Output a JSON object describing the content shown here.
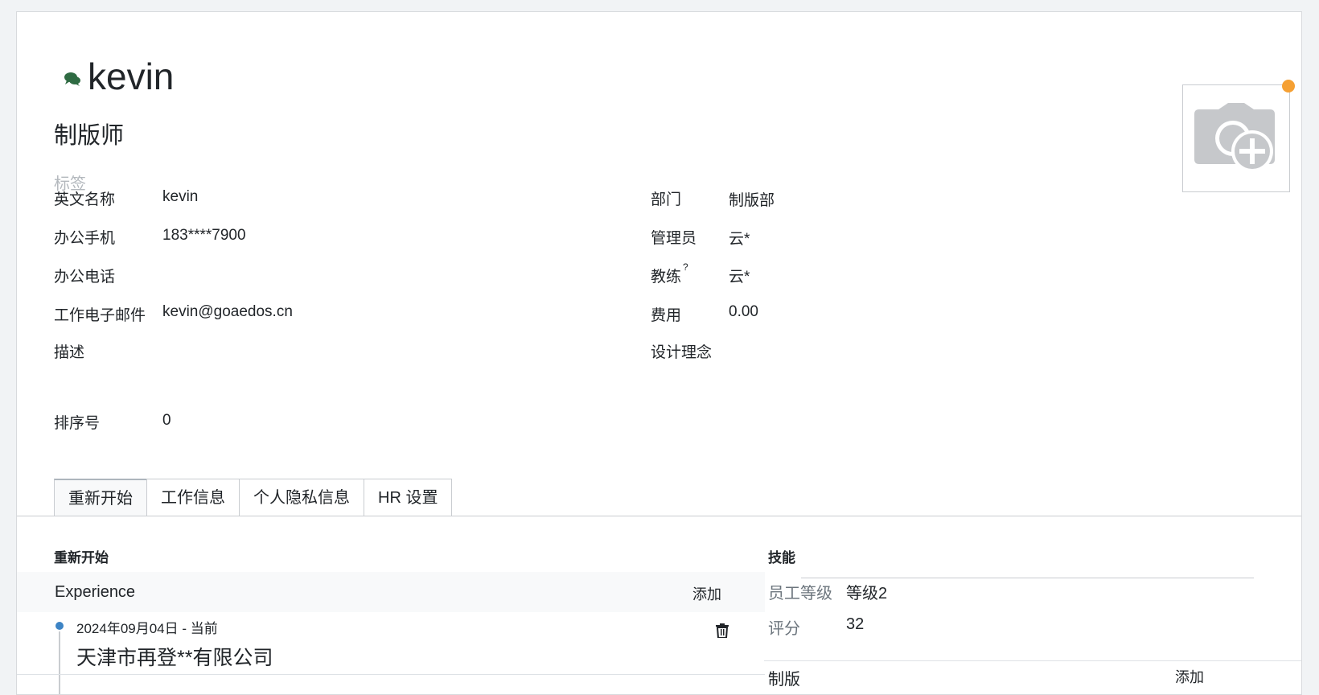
{
  "header": {
    "name": "kevin",
    "job_title": "制版师",
    "tags_placeholder": "标签"
  },
  "left_fields": [
    {
      "label": "英文名称",
      "value": "kevin"
    },
    {
      "label": "办公手机",
      "value": "183****7900"
    },
    {
      "label": "办公电话",
      "value": ""
    },
    {
      "label": "工作电子邮件",
      "value": "kevin@goaedos.cn"
    },
    {
      "label": "描述",
      "value": ""
    },
    {
      "label": "排序号",
      "value": "0"
    }
  ],
  "right_fields": [
    {
      "label": "部门",
      "value": "制版部"
    },
    {
      "label": "管理员",
      "value": "云*"
    },
    {
      "label": "教练",
      "value": "云*",
      "help": "?"
    },
    {
      "label": "费用",
      "value": "0.00"
    },
    {
      "label": "设计理念",
      "value": ""
    }
  ],
  "tabs": [
    "重新开始",
    "工作信息",
    "个人隐私信息",
    "HR 设置"
  ],
  "resume": {
    "section_title": "重新开始",
    "group_title": "Experience",
    "add_label": "添加",
    "entry": {
      "date": "2024年09月04日 - 当前",
      "company": "天津市再登**有限公司"
    }
  },
  "skills": {
    "section_title": "技能",
    "rows": [
      {
        "label": "员工等级",
        "value": "等级2"
      },
      {
        "label": "评分",
        "value": "32"
      }
    ],
    "next_group": "制版",
    "add_label": "添加"
  },
  "colors": {
    "accent_dot": "#f5a033",
    "timeline_dot": "#3d84c5",
    "chat_icon": "#2f6b43"
  },
  "icons": {
    "chat": "chat-bubbles-icon",
    "avatar": "camera-plus-icon",
    "delete": "trash-icon"
  }
}
